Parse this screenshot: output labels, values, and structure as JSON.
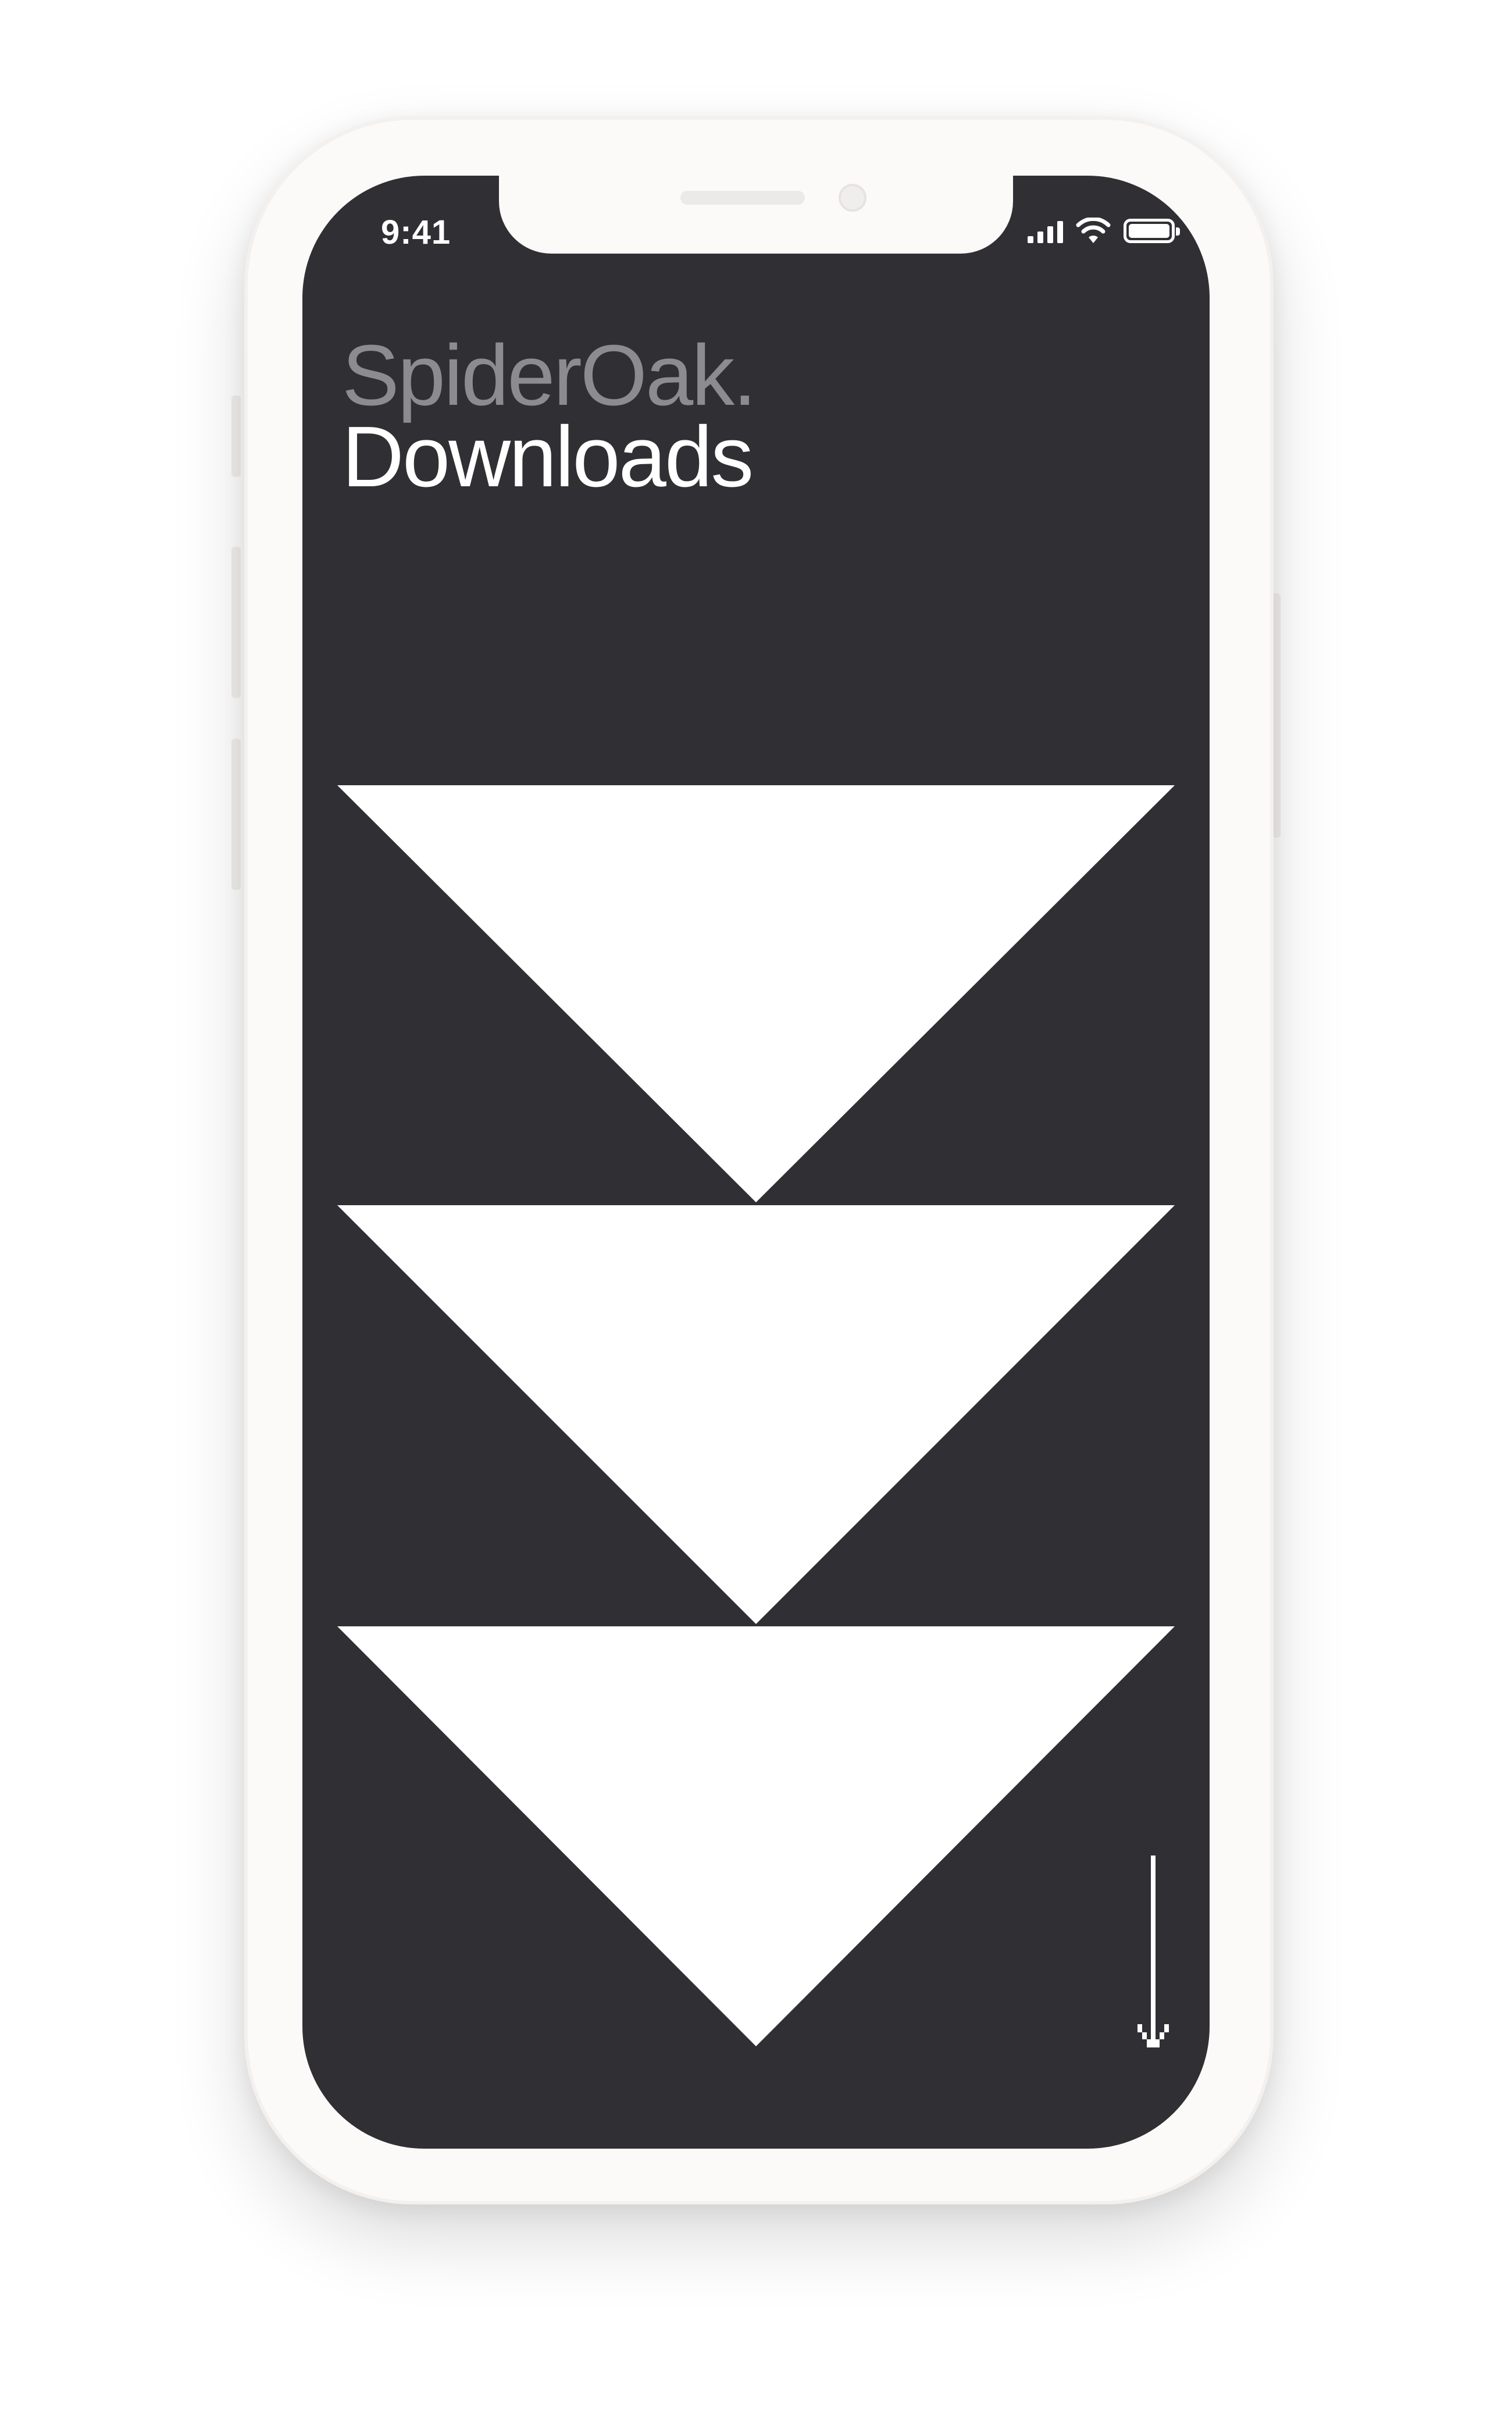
{
  "status_bar": {
    "time": "9:41",
    "icons": [
      "cellular-signal-icon",
      "wifi-icon",
      "battery-icon"
    ]
  },
  "header": {
    "brand": "SpiderOak.",
    "title": "Downloads"
  },
  "graphic": {
    "shape": "three stacked downward-pointing triangles",
    "icon": "download-chevrons-icon"
  },
  "scroll_hint": {
    "icon": "down-arrow-icon"
  },
  "colors": {
    "screen_background": "#302f33",
    "brand_text": "#8c8b8f",
    "title_text": "#ffffff",
    "triangles": "#ffffff",
    "phone_frame": "#fcfaf9"
  }
}
